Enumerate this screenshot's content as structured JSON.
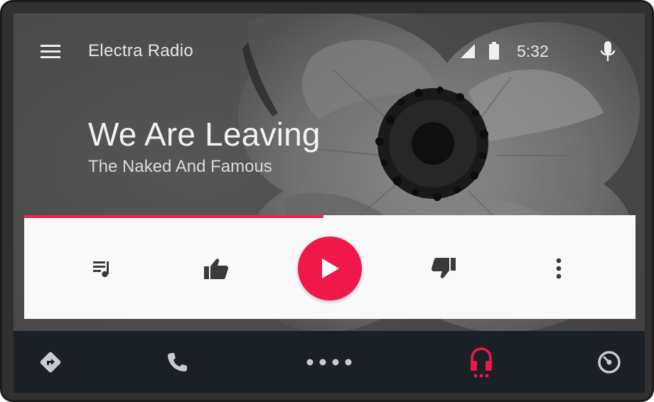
{
  "header": {
    "station_name": "Electra Radio",
    "clock": "5:32",
    "icons": [
      "menu-icon",
      "signal-icon",
      "battery-icon",
      "mic-icon"
    ]
  },
  "now_playing": {
    "title": "We Are Leaving",
    "artist": "The Naked And Famous",
    "progress": 0.49
  },
  "controls": {
    "buttons": [
      "queue-icon",
      "thumb-up-icon",
      "play-icon",
      "thumb-down-icon",
      "more-vert-icon"
    ]
  },
  "navbar": {
    "items": [
      "navigation-icon",
      "phone-icon",
      "home-dots-icon",
      "headphones-icon",
      "overview-icon"
    ],
    "active": "headphones-icon"
  },
  "colors": {
    "accent": "#f0174a",
    "navbar_bg": "#1b1f26",
    "controls_bg": "#f9f9f9",
    "icon_dark": "#3a3a3a",
    "icon_light": "#c8cbd0"
  }
}
